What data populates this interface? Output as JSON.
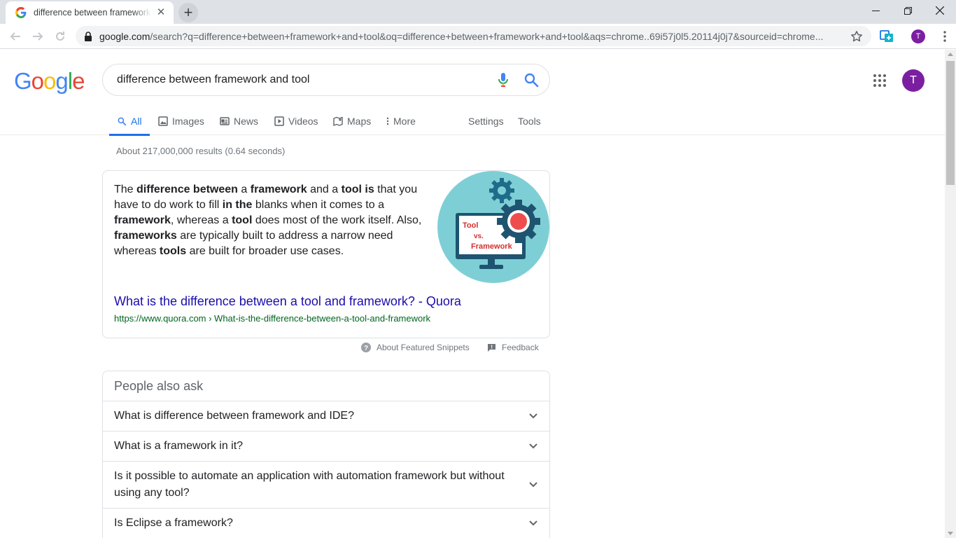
{
  "browser": {
    "tab_title": "difference between framework and tool - Google Search",
    "new_tab_symbol": "+",
    "close_symbol": "✕",
    "url_host": "google.com",
    "url_rest": "/search?q=difference+between+framework+and+tool&oq=difference+between+framework+and+tool&aqs=chrome..69i57j0l5.20114j0j7&sourceid=chrome...",
    "profile_initial": "T"
  },
  "logo": {
    "letters": [
      "G",
      "o",
      "o",
      "g",
      "l",
      "e"
    ],
    "colors": [
      "#4285f4",
      "#ea4335",
      "#fbbc05",
      "#4285f4",
      "#34a853",
      "#ea4335"
    ]
  },
  "search": {
    "query": "difference between framework and tool"
  },
  "account": {
    "initial": "T"
  },
  "tabs": [
    {
      "label": "All",
      "icon": "search-icon"
    },
    {
      "label": "Images",
      "icon": "image-icon"
    },
    {
      "label": "News",
      "icon": "news-icon"
    },
    {
      "label": "Videos",
      "icon": "video-icon"
    },
    {
      "label": "Maps",
      "icon": "map-icon"
    },
    {
      "label": "More",
      "icon": "more-vert-icon"
    }
  ],
  "tools": {
    "settings": "Settings",
    "tools": "Tools"
  },
  "results_stats": "About 217,000,000 results (0.64 seconds)",
  "featured_snippet": {
    "image_labels": [
      "Tool",
      "vs.",
      "Framework"
    ],
    "link_title": "What is the difference between a tool and framework? - Quora",
    "cite_host": "https://www.quora.com",
    "cite_path": " › What-is-the-difference-between-a-tool-and-framework",
    "about_label": "About Featured Snippets",
    "feedback_label": "Feedback"
  },
  "people_also_ask": {
    "title": "People also ask",
    "questions": [
      "What is difference between framework and IDE?",
      "What is a framework in it?",
      "Is it possible to automate an application with automation framework but without using any tool?",
      "Is Eclipse a framework?"
    ]
  }
}
